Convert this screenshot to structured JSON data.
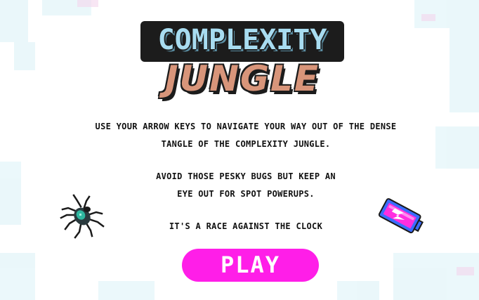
{
  "title": {
    "line1": "COMPLEXITY",
    "line2": "JUNGLE"
  },
  "instructions": {
    "line1": "USE YOUR ARROW KEYS TO NAVIGATE YOUR WAY OUT OF THE DENSE",
    "line2": "TANGLE OF THE COMPLEXITY JUNGLE.",
    "line3": "AVOID THOSE PESKY BUGS BUT KEEP AN",
    "line4": "EYE OUT FOR SPOT POWERUPS.",
    "line5": "IT'S A RACE AGAINST THE CLOCK"
  },
  "play_button": {
    "label": "PLAY"
  },
  "icons": {
    "bug": "spider-bug-icon",
    "powerup": "battery-powerup-icon"
  },
  "colors": {
    "play_button": "#ff1ee8",
    "title_top": "#a8dcf0",
    "title_bottom": "#d8957a",
    "text": "#111111",
    "background": "#ffffff"
  }
}
